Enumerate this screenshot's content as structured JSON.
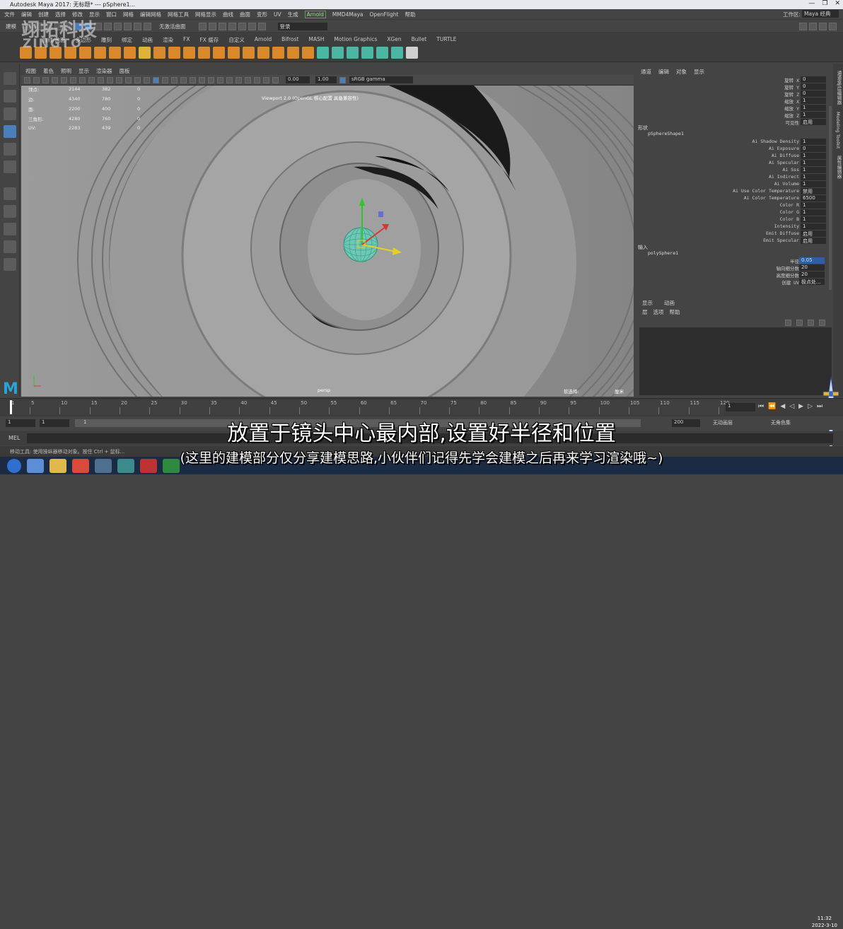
{
  "window": {
    "title": "Autodesk Maya 2017: 无标题*   ---   pSphere1...",
    "controls": [
      "—",
      "❐",
      "✕"
    ]
  },
  "menubar": {
    "items": [
      "文件",
      "编辑",
      "创建",
      "选择",
      "修改",
      "显示",
      "窗口",
      "网格",
      "编辑网格",
      "网格工具",
      "网格显示",
      "曲线",
      "曲面",
      "变形",
      "UV",
      "生成",
      "Arnold",
      "MMD4Maya",
      "OpenFlight",
      "帮助"
    ],
    "workspace_label": "工作区:",
    "workspace_value": "Maya 经典"
  },
  "statusline": {
    "mode": "建模",
    "no_live": "无激活曲面",
    "login": "登录"
  },
  "watermark": {
    "line1": "翊拓科技",
    "line2": "ZINGTO"
  },
  "shelf": {
    "tabs": [
      "曲线/曲面",
      "多边形",
      "雕刻",
      "绑定",
      "动画",
      "渲染",
      "FX",
      "FX 缓存",
      "自定义",
      "Arnold",
      "Bifrost",
      "MASH",
      "Motion Graphics",
      "XGen",
      "Bullet",
      "TURTLE"
    ],
    "icon_colors": [
      "#d9892b",
      "#d9892b",
      "#d9892b",
      "#d9892b",
      "#d9892b",
      "#d9892b",
      "#d9892b",
      "#d9892b",
      "#e0b23a",
      "#d9892b",
      "#d9892b",
      "#d9892b",
      "#d9892b",
      "#d9892b",
      "#d9892b",
      "#d9892b",
      "#d9892b",
      "#d9892b",
      "#d9892b",
      "#d9892b",
      "#4cb6a5",
      "#4cb6a5",
      "#4cb6a5",
      "#4cb6a5",
      "#4cb6a5",
      "#4cb6a5",
      "#cfcfcf"
    ]
  },
  "panel": {
    "menu": [
      "视图",
      "着色",
      "照明",
      "显示",
      "渲染器",
      "面板"
    ],
    "exposure": "0.00",
    "gamma": "1.00",
    "colorspace": "sRGB gamma"
  },
  "hud": {
    "rows": [
      {
        "label": "顶点:",
        "a": "2144",
        "b": "382",
        "c": "0"
      },
      {
        "label": "边:",
        "a": "4340",
        "b": "780",
        "c": "0"
      },
      {
        "label": "面:",
        "a": "2200",
        "b": "400",
        "c": "0"
      },
      {
        "label": "三角形:",
        "a": "4280",
        "b": "760",
        "c": "0"
      },
      {
        "label": "UV:",
        "a": "2283",
        "b": "439",
        "c": "0"
      }
    ],
    "viewport_label": "Viewport 2.0 (OpenGL 核心配置 具备兼容性)",
    "camera": "persp",
    "selection": "软选择:",
    "units": "厘米"
  },
  "attribute_editor": {
    "menu": [
      "通道",
      "编辑",
      "对象",
      "显示"
    ],
    "transform_rows": [
      {
        "label": "旋转 X",
        "value": "0"
      },
      {
        "label": "旋转 Y",
        "value": "0"
      },
      {
        "label": "旋转 Z",
        "value": "0"
      },
      {
        "label": "缩放 X",
        "value": "1"
      },
      {
        "label": "缩放 Y",
        "value": "1"
      },
      {
        "label": "缩放 Z",
        "value": "1"
      },
      {
        "label": "可见性",
        "value": "启用"
      }
    ],
    "shapes_header": "形状",
    "shape_name": "pSphereShape1",
    "shape_rows": [
      {
        "label": "Ai Shadow Density",
        "value": "1"
      },
      {
        "label": "Ai Exposure",
        "value": "0"
      },
      {
        "label": "Ai Diffuse",
        "value": "1"
      },
      {
        "label": "Ai Specular",
        "value": "1"
      },
      {
        "label": "Ai Sss",
        "value": "1"
      },
      {
        "label": "Ai Indirect",
        "value": "1"
      },
      {
        "label": "Ai Volume",
        "value": "1"
      },
      {
        "label": "Ai Use Color Temperature",
        "value": "禁用"
      },
      {
        "label": "Ai Color Temperature",
        "value": "6500"
      },
      {
        "label": "Color R",
        "value": "1"
      },
      {
        "label": "Color G",
        "value": "1"
      },
      {
        "label": "Color B",
        "value": "1"
      },
      {
        "label": "Intensity",
        "value": "1"
      },
      {
        "label": "Emit Diffuse",
        "value": "启用"
      },
      {
        "label": "Emit Specular",
        "value": "启用"
      }
    ],
    "inputs_header": "输入",
    "input_name": "polySphere1",
    "input_rows": [
      {
        "label": "半径",
        "value": "0.05"
      },
      {
        "label": "轴向细分数",
        "value": "20"
      },
      {
        "label": "高度细分数",
        "value": "20"
      },
      {
        "label": "创建 UV",
        "value": "极点处..."
      }
    ]
  },
  "layer_editor": {
    "tabs": [
      "显示",
      "动画"
    ],
    "menu": [
      "层",
      "选项",
      "帮助"
    ]
  },
  "side_tabs": [
    "通道盒/层编辑器",
    "Modeling Toolkit",
    "属性编辑器"
  ],
  "timeline": {
    "ticks": [
      "1",
      "5",
      "10",
      "15",
      "20",
      "25",
      "30",
      "35",
      "40",
      "45",
      "50",
      "55",
      "60",
      "65",
      "70",
      "75",
      "80",
      "85",
      "90",
      "95",
      "100",
      "105",
      "110",
      "115",
      "120"
    ],
    "current_frame": "1"
  },
  "range": {
    "start": "1",
    "start2": "1",
    "slider_label": "1",
    "end": "200",
    "anim_layer": "无动画层",
    "char_set": "无角色集"
  },
  "cmdline": {
    "label": "MEL"
  },
  "helpline": {
    "text": "移动工具: 使用操纵器移动对象。按住 Ctrl + 鼠标..."
  },
  "subtitles": {
    "line1": "放置于镜头中心最内部,设置好半径和位置",
    "line2": "(这里的建模部分仅分享建模思路,小伙伴们记得先学会建模之后再来学习渲染哦~)"
  },
  "taskbar": {
    "time": "11:32",
    "date": "2022-3-10"
  }
}
